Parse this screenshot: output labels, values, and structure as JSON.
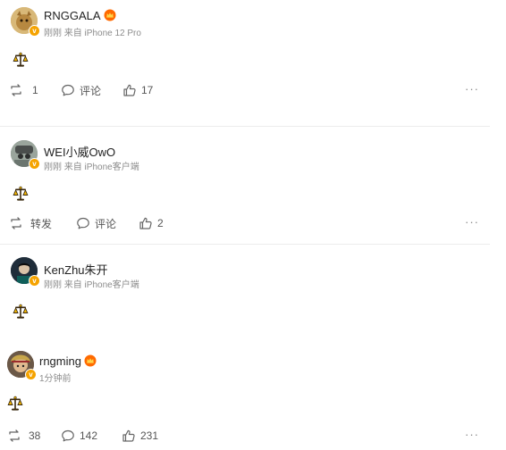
{
  "posts": [
    {
      "username": "RNGGALA",
      "meta": "刚刚 来自 iPhone 12 Pro",
      "repost": "1",
      "comment": "评论",
      "like": "17",
      "avatar_color": "#c9a35a"
    },
    {
      "username": "WEI小威OwO",
      "meta": "刚刚 来自 iPhone客户端",
      "repost": "转发",
      "comment": "评论",
      "like": "2",
      "avatar_color": "#7c8a80"
    },
    {
      "username": "KenZhu朱开",
      "meta": "刚刚 来自 iPhone客户端"
    },
    {
      "username": "rngming",
      "meta": "1分钟前",
      "repost": "38",
      "comment": "142",
      "like": "231",
      "avatar_color": "#5b4a3e"
    }
  ],
  "icons": {
    "emoji": "balance-scale-emoji",
    "repost": "repost-icon",
    "comment": "comment-icon",
    "like": "thumbs-up-icon",
    "more": "more-icon"
  },
  "accent": "#f5a300",
  "more_label": "···"
}
